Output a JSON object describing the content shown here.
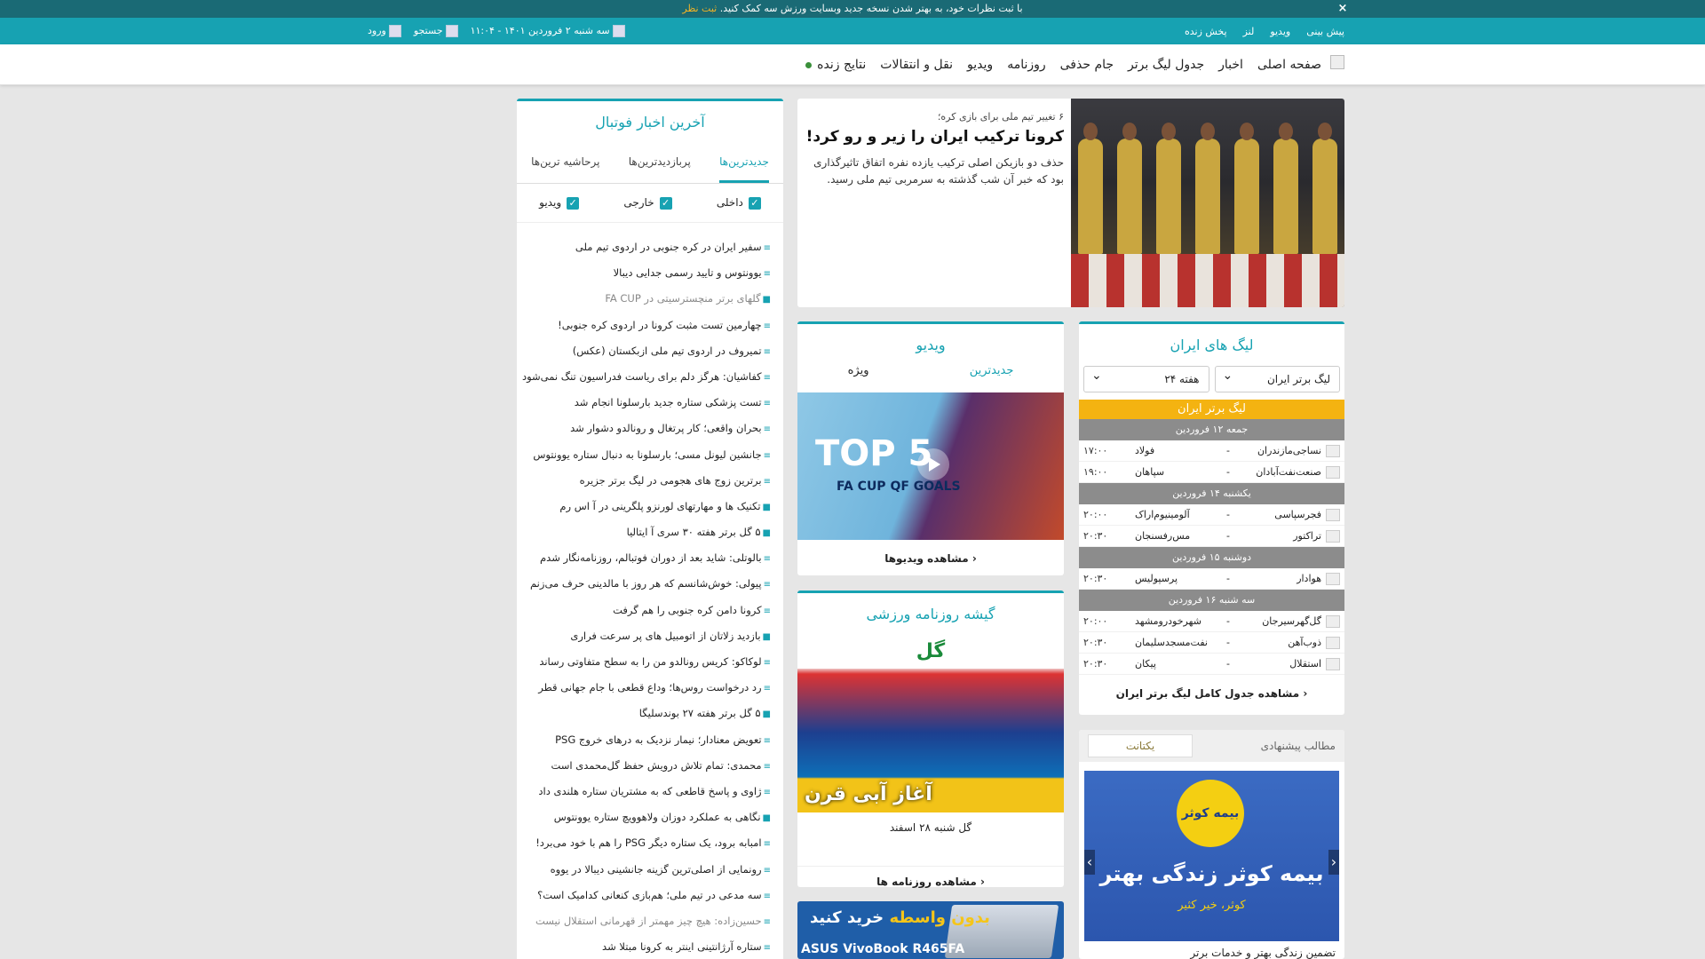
{
  "notice": {
    "text": "با ثبت نظرات خود، به بهتر شدن نسخه جدید وبسایت ورزش سه کمک کنید.",
    "link": "ثبت نظر",
    "close": "×"
  },
  "topbar": {
    "links": [
      "پیش بینی",
      "ویدیو",
      "لنز",
      "پخش زنده"
    ],
    "date": "سه شنبه ۲ فروردین ۱۴۰۱ - ۱۱:۰۴",
    "search": "جستجو",
    "login": "ورود"
  },
  "nav": {
    "items": [
      "صفحه اصلی",
      "اخبار",
      "جدول لیگ برتر",
      "جام حذفی",
      "روزنامه",
      "ویدیو",
      "نقل و انتقالات",
      "نتایج زنده"
    ]
  },
  "featured": {
    "kicker": "۶ تغییر تیم ملی برای بازی کره؛",
    "headline": "کرونا ترکیب ایران را زیر و رو کرد!",
    "lead": "حذف دو بازیکن اصلی ترکیب یازده نفره اتفاق تاثیرگذاری بود که خبر آن شب گذشته به سرمربی تیم ملی رسید."
  },
  "news": {
    "title": "آخرین اخبار فوتبال",
    "tabs": [
      "جدیدترین‌ها",
      "پربازدیدترین‌ها",
      "پرحاشیه ترین‌ها"
    ],
    "filters": [
      "داخلی",
      "خارجی",
      "ویدیو"
    ],
    "items": [
      {
        "text": "سفیر ایران در کره جنوبی در اردوی تیم ملی",
        "icon": "≡"
      },
      {
        "text": "یوونتوس و تایید رسمی جدایی دیبالا",
        "icon": "≡"
      },
      {
        "text": "گلهای برتر منچسترسیتی در FA CUP",
        "icon": "■",
        "dim": true
      },
      {
        "text": "چهارمین تست مثبت کرونا در اردوی کره جنوبی!",
        "icon": "≡"
      },
      {
        "text": "تمیروف در اردوی تیم ملی ازبکستان (عکس)",
        "icon": "≡"
      },
      {
        "text": "کفاشیان: هرگز دلم برای ریاست فدراسیون تنگ نمی‌شود",
        "icon": "≡"
      },
      {
        "text": "تست پزشکی ستاره جدید بارسلونا انجام شد",
        "icon": "≡"
      },
      {
        "text": "بحران واقعی؛ کار پرتغال و رونالدو دشوار شد",
        "icon": "≡"
      },
      {
        "text": "جانشین لیونل مسی؛ بارسلونا به دنبال ستاره یوونتوس",
        "icon": "≡"
      },
      {
        "text": "برترین زوج های هجومی در لیگ برتر جزیره",
        "icon": "≡"
      },
      {
        "text": "تکنیک ها و مهارتهای لورنزو پلگرینی در آ اس رم",
        "icon": "■"
      },
      {
        "text": "۵ گل برتر هفته ۳۰ سری آ ایتالیا",
        "icon": "■"
      },
      {
        "text": "بالوتلی: شاید بعد از دوران فوتبالم، روزنامه‌نگار شدم",
        "icon": "≡"
      },
      {
        "text": "پیولی: خوش‌شانسم که هر روز با مالدینی حرف می‌زنم",
        "icon": "≡"
      },
      {
        "text": "کرونا دامن کره جنوبی را هم گرفت",
        "icon": "≡"
      },
      {
        "text": "بازدید زلاتان از اتومبیل های پر سرعت فراری",
        "icon": "■"
      },
      {
        "text": "لوکاکو: کریس رونالدو من را به سطح متفاوتی رساند",
        "icon": "≡"
      },
      {
        "text": "رد درخواست روس‌ها؛ وداع قطعی با جام جهانی قطر",
        "icon": "≡"
      },
      {
        "text": "۵ گل برتر هفته ۲۷ بوندسلیگا",
        "icon": "■"
      },
      {
        "text": "تعویض معنادار؛ نیمار نزدیک به درهای خروج PSG",
        "icon": "≡"
      },
      {
        "text": "محمدی: تمام تلاش درویش حفظ گل‌محمدی است",
        "icon": "≡"
      },
      {
        "text": "ژاوی و پاسخ قاطعی که به مشتریان ستاره هلندی داد",
        "icon": "≡"
      },
      {
        "text": "نگاهی به عملکرد دوزان ولاهوویچ ستاره یوونتوس",
        "icon": "■"
      },
      {
        "text": "امبابه برود، یک ستاره دیگر PSG را هم با خود می‌برد!",
        "icon": "≡"
      },
      {
        "text": "رونمایی از اصلی‌ترین گزینه جانشینی دیبالا در یووه",
        "icon": "≡"
      },
      {
        "text": "سه مدعی در تیم ملی؛ هم‌بازی کنعانی کدامیک است؟",
        "icon": "≡"
      },
      {
        "text": "حسین‌زاده: هیچ چیز مهمتر از قهرمانی استقلال نیست",
        "icon": "≡",
        "dim": true
      },
      {
        "text": "ستاره آرژانتینی اینتر به کرونا مبتلا شد",
        "icon": "≡"
      }
    ]
  },
  "leagues": {
    "title": "لیگ های ایران",
    "league_select": "لیگ برتر ایران",
    "week_select": "هفته ۲۴",
    "league_header": "لیگ برتر ایران",
    "days": [
      {
        "label": "جمعه ۱۲ فروردین",
        "matches": [
          {
            "home": "نساجی‌مازندران",
            "away": "فولاد",
            "time": "۱۷:۰۰"
          },
          {
            "home": "صنعت‌نفت‌آبادان",
            "away": "سپاهان",
            "time": "۱۹:۰۰"
          }
        ]
      },
      {
        "label": "یکشنبه ۱۴ فروردین",
        "matches": [
          {
            "home": "فجرسپاسی",
            "away": "آلومینیوم‌اراک",
            "time": "۲۰:۰۰"
          },
          {
            "home": "تراکتور",
            "away": "مس‌رفسنجان",
            "time": "۲۰:۳۰"
          }
        ]
      },
      {
        "label": "دوشنبه ۱۵ فروردین",
        "matches": [
          {
            "home": "هوادار",
            "away": "پرسپولیس",
            "time": "۲۰:۳۰"
          }
        ]
      },
      {
        "label": "سه شنبه ۱۶ فروردین",
        "matches": [
          {
            "home": "گل‌گهرسیرجان",
            "away": "شهرخودرومشهد",
            "time": "۲۰:۰۰"
          },
          {
            "home": "ذوب‌آهن",
            "away": "نفت‌مسجدسلیمان",
            "time": "۲۰:۳۰"
          },
          {
            "home": "استقلال",
            "away": "پیکان",
            "time": "۲۰:۳۰"
          }
        ]
      }
    ],
    "more": "مشاهده جدول کامل لیگ برتر ایران"
  },
  "video": {
    "title": "ویدیو",
    "tabs": [
      "جدیدترین",
      "ویژه"
    ],
    "thumb_top": "TOP 5",
    "thumb_sub": "FA CUP QF GOALS",
    "more": "مشاهده ویدیوها"
  },
  "paper": {
    "title": "گیشه روزنامه ورزشی",
    "masthead": "گل",
    "headline": "آغاز آبی قرن",
    "caption": "گل شنبه ۲۸ اسفند",
    "more": "مشاهده روزنامه ها"
  },
  "suggest": {
    "label": "مطالب پیشنهادی",
    "brand": "یکتانت",
    "ad_circle": "بیمه کوثر",
    "ad_slogan": "بیمه کوثر زندگی بهتر",
    "ad_sub": "کوثر، خیر کثیر",
    "caption": "تضمین زندگی بهتر و خدمات برتر"
  },
  "bottomad": {
    "line1_a": "بدون واسطه",
    "line1_b": "خرید کنید",
    "line2": "ASUS VivoBook R465FA"
  },
  "colors": {
    "accent": "#17a2b2",
    "notice_bg": "#1a6a75",
    "league_header": "#f4b311",
    "day_bg": "#8c8c8c"
  }
}
